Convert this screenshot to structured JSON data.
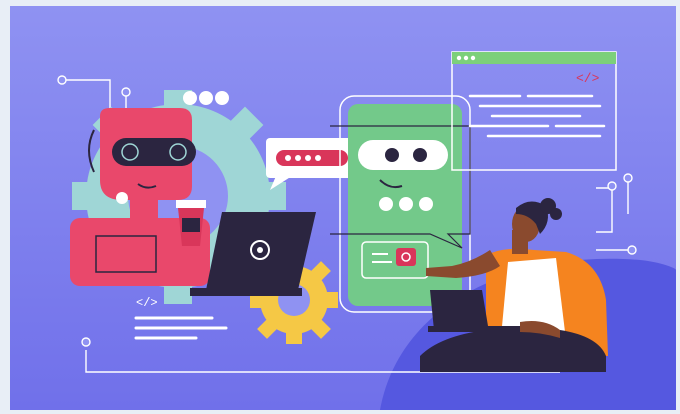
{
  "illustration": {
    "subject": "",
    "colors": {
      "frame": "#e8eef6",
      "background_top": "#8f92f2",
      "background_bottom": "#6d6ee8",
      "robot_pink": "#e9486b",
      "gear_teal": "#9fd6d6",
      "gear_yellow": "#f5c845",
      "phone_green": "#73c98a",
      "window_green": "#7cd07a",
      "person_orange": "#f5841f",
      "hill_blue": "#5558e0",
      "ink_dark": "#2b2540",
      "accent_red": "#d9365a"
    },
    "icons": [
      "robot-icon",
      "gear-icon",
      "laptop-icon",
      "coffee-cup-icon",
      "chat-bubble-icon",
      "phone-icon",
      "code-window-icon",
      "person-icon",
      "code-brackets-icon"
    ]
  }
}
